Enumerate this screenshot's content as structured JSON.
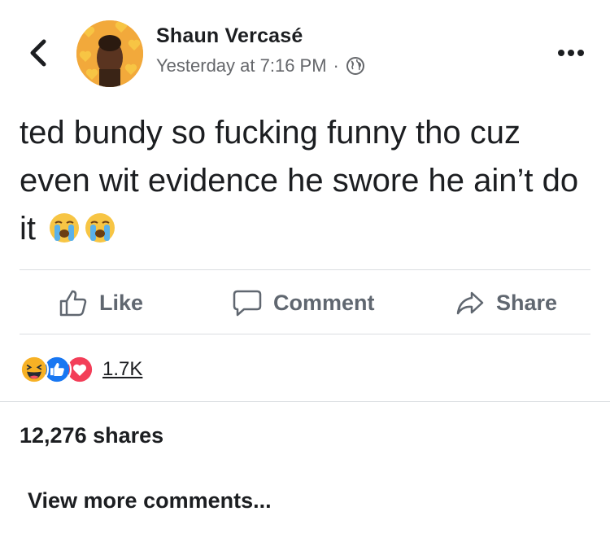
{
  "header": {
    "author": "Shaun Vercasé",
    "timestamp": "Yesterday at 7:16 PM",
    "separator": "·",
    "privacy_icon": "globe-icon",
    "back_icon": "chevron-left-icon",
    "more_icon": "more-horizontal-icon"
  },
  "post": {
    "text": "ted bundy so fucking funny tho cuz even wit evidence he swore he ain’t do it",
    "emojis": [
      "loudly-crying-face",
      "loudly-crying-face"
    ]
  },
  "actions": {
    "like": "Like",
    "comment": "Comment",
    "share": "Share"
  },
  "reactions": {
    "icons": [
      "haha",
      "like",
      "love"
    ],
    "count": "1.7K"
  },
  "stats": {
    "shares": "12,276 shares"
  },
  "footer": {
    "view_more": "View more comments..."
  },
  "colors": {
    "text": "#1c1e21",
    "secondary": "#65676b",
    "action_gray": "#606770",
    "like_blue": "#1877f2",
    "love_red": "#f33e58",
    "haha_yellow": "#f7b125",
    "divider": "#dadde1"
  }
}
